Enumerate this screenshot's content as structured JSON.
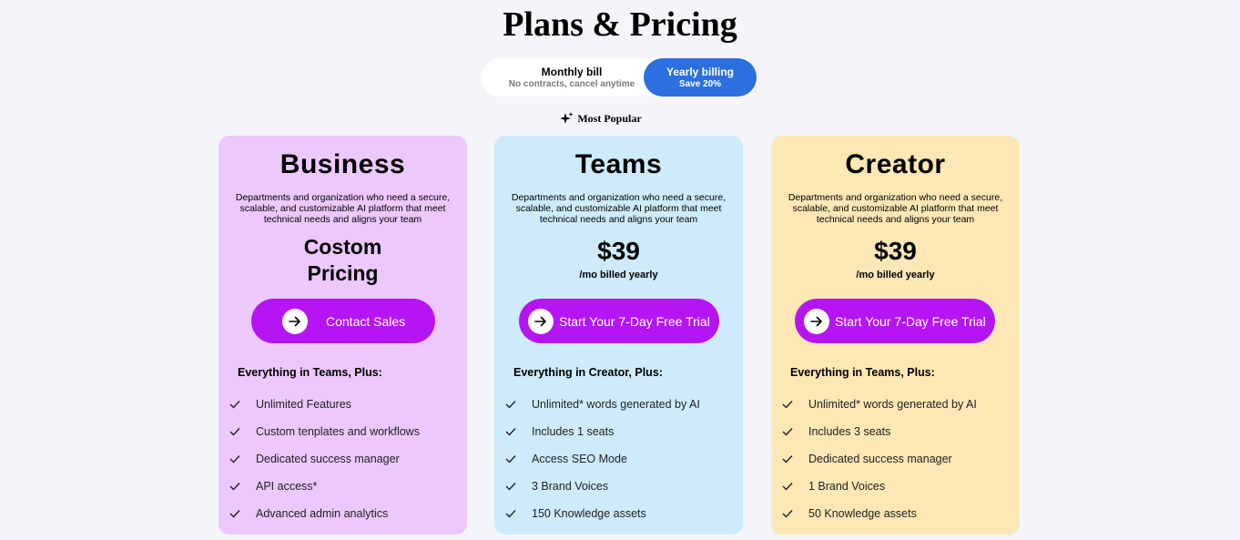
{
  "page": {
    "title": "Plans & Pricing"
  },
  "billing_toggle": {
    "monthly": {
      "label": "Monthly bill",
      "sublabel": "No contracts, cancel anytime"
    },
    "yearly": {
      "label": "Yearly billing",
      "sublabel": "Save 20%",
      "selected": true
    }
  },
  "most_popular": {
    "label": "Most Popular",
    "icon": "sparkles-icon"
  },
  "colors": {
    "accent_blue": "#2b6fe0",
    "cta_purple": "#b515f2",
    "business_bg": "#ecc8fd",
    "teams_bg": "#cdebfa",
    "creator_bg": "#fde7b5",
    "page_bg": "#f4f5f9"
  },
  "plans": [
    {
      "name": "Business",
      "description": "Departments and organization who need a secure, scalable, and customizable AI platform that meet technical needs and aligns your team",
      "price": "",
      "price_line1": "Costom",
      "price_line2": "Pricing",
      "price_note": "",
      "cta_label": "Contact Sales",
      "features_heading": "Everything in Teams, Plus:",
      "features": [
        "Unlimited Features",
        "Custom tenplates and workflows",
        "Dedicated success manager",
        "API access*",
        "Advanced admin analytics"
      ]
    },
    {
      "name": "Teams",
      "description": "Departments and organization who need a secure, scalable, and customizable AI platform that meet technical needs and aligns your team",
      "price": "$39",
      "price_note": "/mo billed yearly",
      "cta_label": "Start Your 7-Day Free Trial",
      "features_heading": "Everything in Creator, Plus:",
      "features": [
        "Unlimited* words generated by AI",
        "Includes 1 seats",
        "Access SEO Mode",
        "3 Brand Voices",
        "150 Knowledge assets"
      ]
    },
    {
      "name": "Creator",
      "description": "Departments and organization who need a secure, scalable, and customizable AI platform that meet technical needs and aligns your team",
      "price": "$39",
      "price_note": "/mo billed yearly",
      "cta_label": "Start Your 7-Day Free Trial",
      "features_heading": "Everything in Teams, Plus:",
      "features": [
        "Unlimited* words generated by AI",
        "Includes 3 seats",
        "Dedicated success manager",
        "1 Brand Voices",
        "50 Knowledge assets"
      ]
    }
  ]
}
